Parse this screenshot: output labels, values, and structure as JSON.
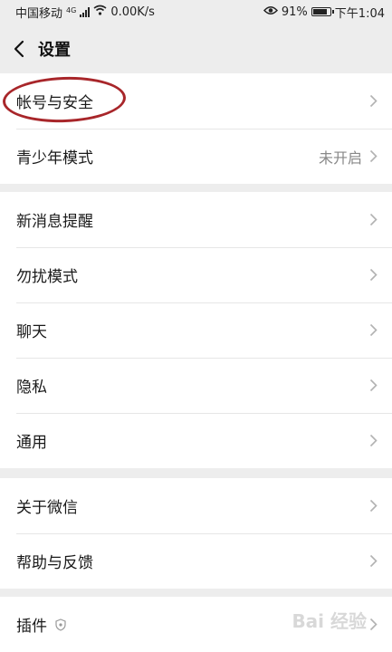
{
  "status_bar": {
    "carrier": "中国移动",
    "network": "4G",
    "speed": "0.00K/s",
    "battery": "91%",
    "battery_level": 0.91,
    "time": "下午1:04"
  },
  "nav": {
    "title": "设置"
  },
  "groups": [
    {
      "items": [
        {
          "label": "帐号与安全"
        },
        {
          "label": "青少年模式",
          "value": "未开启"
        }
      ]
    },
    {
      "items": [
        {
          "label": "新消息提醒"
        },
        {
          "label": "勿扰模式"
        },
        {
          "label": "聊天"
        },
        {
          "label": "隐私"
        },
        {
          "label": "通用"
        }
      ]
    },
    {
      "items": [
        {
          "label": "关于微信"
        },
        {
          "label": "帮助与反馈"
        }
      ]
    },
    {
      "items": [
        {
          "label": "插件"
        }
      ]
    }
  ],
  "watermark": "Bai 经验",
  "colors": {
    "background": "#ededed",
    "annotation_circle": "#a8262a"
  }
}
